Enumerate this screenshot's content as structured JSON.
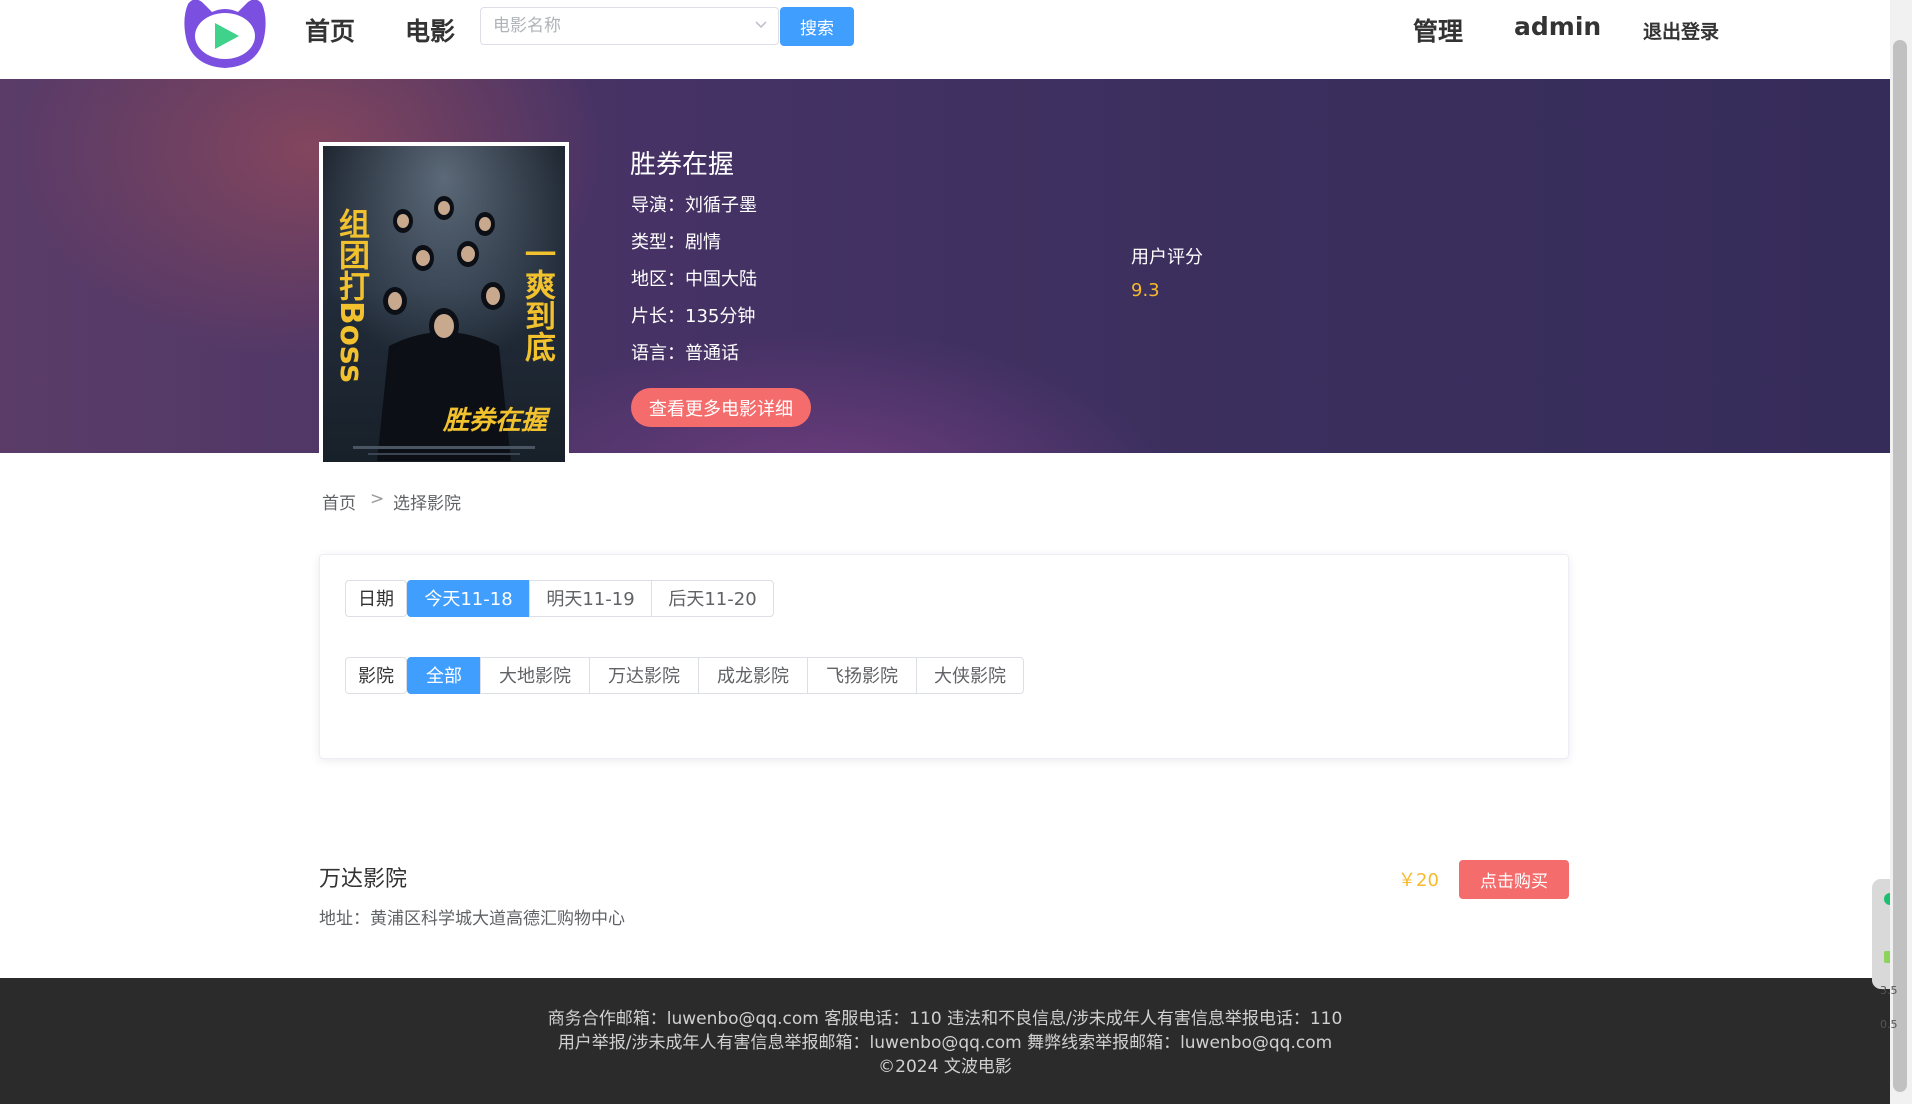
{
  "header": {
    "nav_home": "首页",
    "nav_movie": "电影",
    "search_placeholder": "电影名称",
    "search_button": "搜索",
    "admin_link": "管理",
    "username": "admin",
    "logout": "退出登录"
  },
  "movie": {
    "title": "胜券在握",
    "director": "导演：刘循子墨",
    "genre": "类型：剧情",
    "region": "地区：中国大陆",
    "duration": "片长：135分钟",
    "language": "语言：普通话",
    "detail_button": "查看更多电影详细",
    "rating_label": "用户评分",
    "rating_value": "9.3",
    "poster": {
      "left_slogan": "组团打Boss",
      "right_slogan": "一爽到底",
      "title_art": "胜券在握"
    }
  },
  "breadcrumb": {
    "home": "首页",
    "separator": ">",
    "current": "选择影院"
  },
  "filters": {
    "date_label": "日期",
    "dates": [
      "今天11-18",
      "明天11-19",
      "后天11-20"
    ],
    "cinema_label": "影院",
    "cinemas": [
      "全部",
      "大地影院",
      "万达影院",
      "成龙影院",
      "飞扬影院",
      "大侠影院"
    ]
  },
  "listing": {
    "name": "万达影院",
    "address": "地址：黄浦区科学城大道高德汇购物中心",
    "price": "￥20",
    "buy_button": "点击购买"
  },
  "footer": {
    "line1": "商务合作邮箱：luwenbo@qq.com 客服电话：110 违法和不良信息/涉未成年人有害信息举报电话：110",
    "line2": "用户举报/涉未成年人有害信息举报邮箱：luwenbo@qq.com 舞弊线索举报邮箱：luwenbo@qq.com",
    "line3": "©2024 文波电影"
  },
  "widget": {
    "up_speed": "3.5",
    "down_speed": "0.5"
  },
  "colors": {
    "primary": "#409eff",
    "accent_red": "#f56c6c",
    "rating_gold": "#f7ba2a",
    "footer_bg": "#2b2b2b",
    "logo_purple": "#7b4fe0",
    "logo_green": "#3ed28a"
  }
}
